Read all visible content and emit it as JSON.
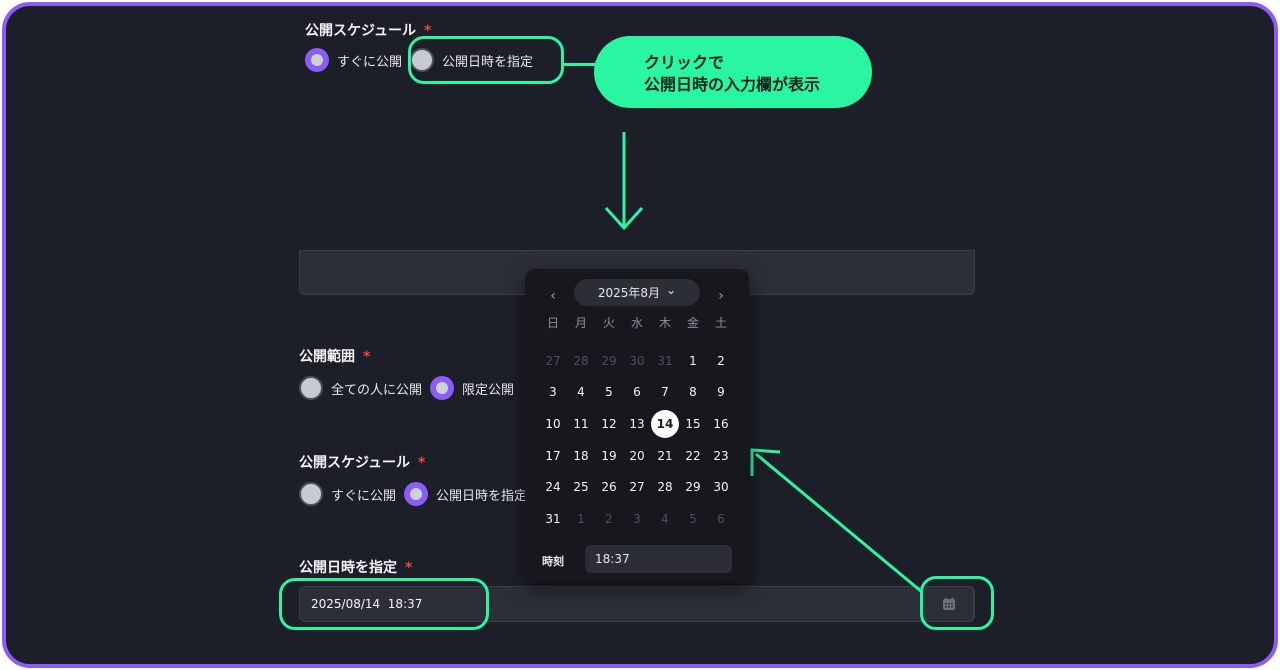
{
  "top": {
    "schedule_label": "公開スケジュール",
    "required_mark": "*",
    "option_now": "すぐに公開",
    "option_datetime": "公開日時を指定"
  },
  "callout": {
    "line1": "クリックで",
    "line2": "公開日時の入力欄が表示"
  },
  "form": {
    "visibility_label": "公開範囲",
    "visibility_option_all": "全ての人に公開",
    "visibility_option_limited": "限定公開",
    "schedule_label": "公開スケジュール",
    "schedule_option_now": "すぐに公開",
    "schedule_option_datetime": "公開日時を指定",
    "datetime_label": "公開日時を指定",
    "required_mark": "*",
    "datetime_value": "2025/08/14  18:37"
  },
  "calendar": {
    "month_title": "2025年8月",
    "prev_glyph": "‹",
    "next_glyph": "›",
    "dropdown_glyph": "⌄",
    "weekdays": [
      "日",
      "月",
      "火",
      "水",
      "木",
      "金",
      "土"
    ],
    "days": [
      [
        "27",
        "28",
        "29",
        "30",
        "31",
        "1",
        "2"
      ],
      [
        "3",
        "4",
        "5",
        "6",
        "7",
        "8",
        "9"
      ],
      [
        "10",
        "11",
        "12",
        "13",
        "14",
        "15",
        "16"
      ],
      [
        "17",
        "18",
        "19",
        "20",
        "21",
        "22",
        "23"
      ],
      [
        "24",
        "25",
        "26",
        "27",
        "28",
        "29",
        "30"
      ],
      [
        "31",
        "1",
        "2",
        "3",
        "4",
        "5",
        "6"
      ]
    ],
    "selected_day": "14",
    "time_label": "時刻",
    "time_value": "18:37"
  },
  "colors": {
    "accent_purple": "#8b5cf6",
    "highlight_green": "#2af5a0",
    "required_red": "#ef4444",
    "background": "#1c1f27"
  }
}
